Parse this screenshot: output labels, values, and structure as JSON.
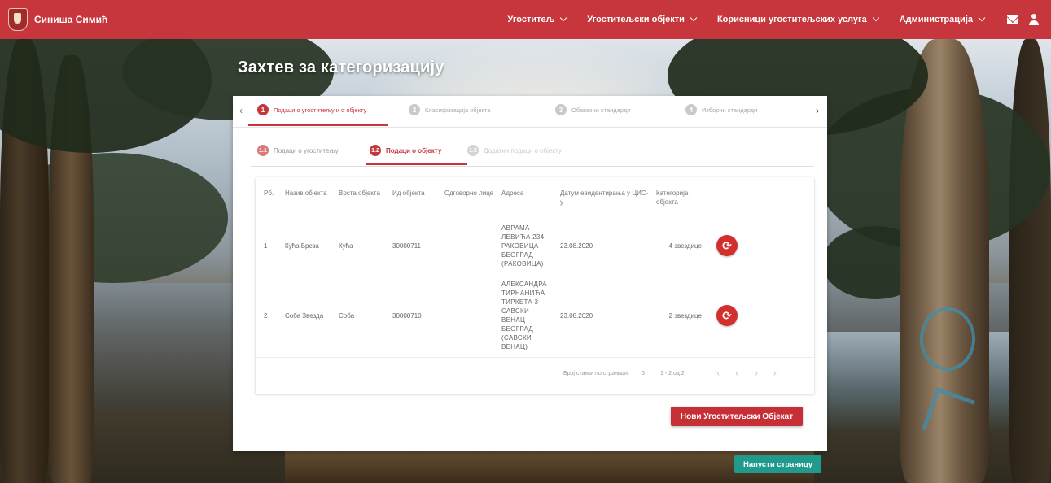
{
  "app": {
    "brand": "Синиша Симић"
  },
  "nav": {
    "items": [
      {
        "label": "Угоститељ"
      },
      {
        "label": "Угоститељски објекти"
      },
      {
        "label": "Корисници угоститељских услуга"
      },
      {
        "label": "Администрација"
      }
    ]
  },
  "page": {
    "title": "Захтев за категоризацију"
  },
  "stepper": {
    "steps": [
      {
        "num": "1",
        "label": "Подаци о угоститељу и о објекту"
      },
      {
        "num": "2",
        "label": "Класификација објекта"
      },
      {
        "num": "3",
        "label": "Обавезни стандарди"
      },
      {
        "num": "4",
        "label": "Изборни стандарди"
      }
    ]
  },
  "substeps": [
    {
      "num": "1.1",
      "label": "Подаци о угоститељу"
    },
    {
      "num": "1.2",
      "label": "Подаци о објекту"
    },
    {
      "num": "1.3",
      "label": "Додатни подаци о објекту"
    }
  ],
  "table": {
    "headers": {
      "rb": "Рб.",
      "name": "Назив објекта",
      "type": "Врста објекта",
      "id": "Ид објекта",
      "person": "Одговорно лице",
      "address": "Адреса",
      "date": "Датум евидентирања у ЦИС-у",
      "category": "Категорија објекта"
    },
    "rows": [
      {
        "rb": "1",
        "name": "Кућа Бреза",
        "type": "Кућа",
        "id": "30000711",
        "person": "",
        "address": "АВРАМА ЛЕВИЋА 234 РАКОВИЦА БЕОГРАД (РАКОВИЦА)",
        "date": "23.08.2020",
        "category": "4 звездице"
      },
      {
        "rb": "2",
        "name": "Соба Звезда",
        "type": "Соба",
        "id": "30000710",
        "person": "",
        "address": "АЛЕКСАНДРА ТИРНАНИЋА ТИРКЕТА 3 САВСКИ ВЕНАЦ БЕОГРАД (САВСКИ ВЕНАЦ)",
        "date": "23.08.2020",
        "category": "2 звездице"
      }
    ]
  },
  "paginator": {
    "label": "Број ставки по страници:",
    "size": "5",
    "range": "1 - 2 од 2"
  },
  "buttons": {
    "new_object": "Нови Угоститељски Објекат",
    "leave_page": "Напусти страницу"
  },
  "colors": {
    "primary": "#c6363c",
    "teal": "#1f9a8c"
  }
}
